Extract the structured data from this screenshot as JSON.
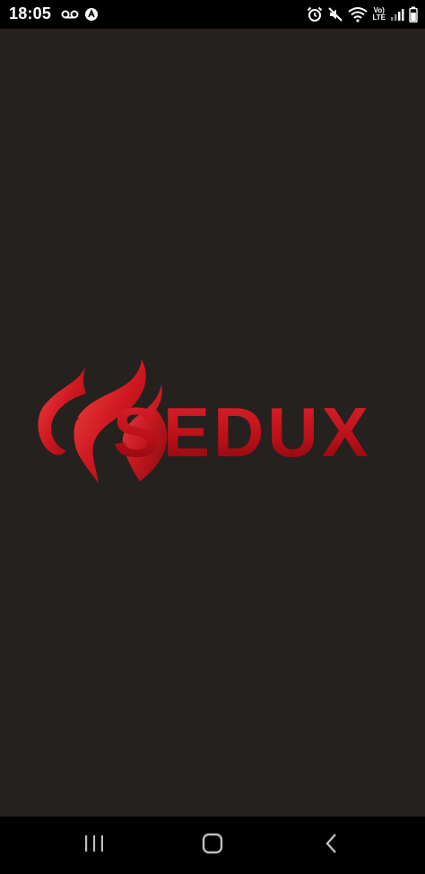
{
  "status_bar": {
    "time": "18:05",
    "left_icons": [
      "voicemail-icon",
      "app-notification-icon"
    ],
    "right_icons": [
      "alarm-icon",
      "mute-icon",
      "wifi-icon",
      "volte-lte-icon",
      "signal-icon",
      "battery-icon"
    ],
    "lte_top": "Vo)",
    "lte_bottom": "LTE"
  },
  "splash": {
    "brand_name": "SEDUX",
    "brand_color": "#c8101a",
    "background": "#25211e"
  },
  "nav_bar": {
    "buttons": [
      "recents-button",
      "home-button",
      "back-button"
    ]
  }
}
